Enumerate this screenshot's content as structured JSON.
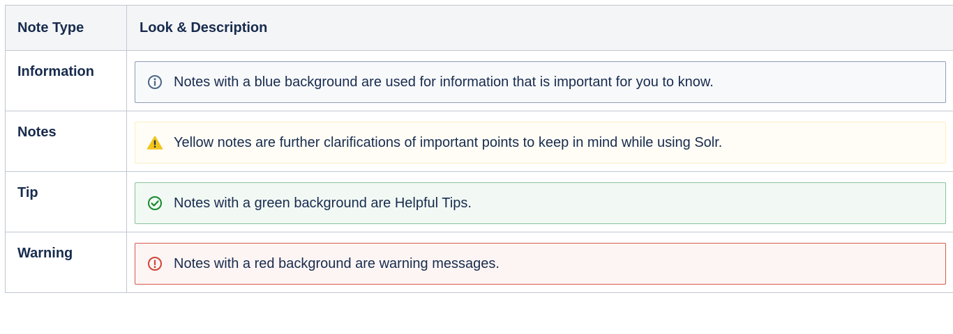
{
  "table": {
    "headers": {
      "note_type": "Note Type",
      "look_description": "Look & Description"
    },
    "rows": [
      {
        "type": "Information",
        "description": "Notes with a blue background are used for information that is important for you to know.",
        "icon": "info-icon",
        "icon_color": "#4a6785",
        "panel_background": "#f8f9fb",
        "panel_border": "#8d9cb5"
      },
      {
        "type": "Notes",
        "description": "Yellow notes are further clarifications of important points to keep in mind while using Solr.",
        "icon": "warning-triangle-icon",
        "icon_color": "#f2c41c",
        "panel_background": "#fffdf6",
        "panel_border": "#fcefc0"
      },
      {
        "type": "Tip",
        "description": "Notes with a green background are Helpful Tips.",
        "icon": "check-circle-icon",
        "icon_color": "#14892c",
        "panel_background": "#f2f9f4",
        "panel_border": "#87c29c"
      },
      {
        "type": "Warning",
        "description": "Notes with a red background are warning messages.",
        "icon": "error-circle-icon",
        "icon_color": "#d04437",
        "panel_background": "#fdf5f4",
        "panel_border": "#d55a49"
      }
    ]
  }
}
